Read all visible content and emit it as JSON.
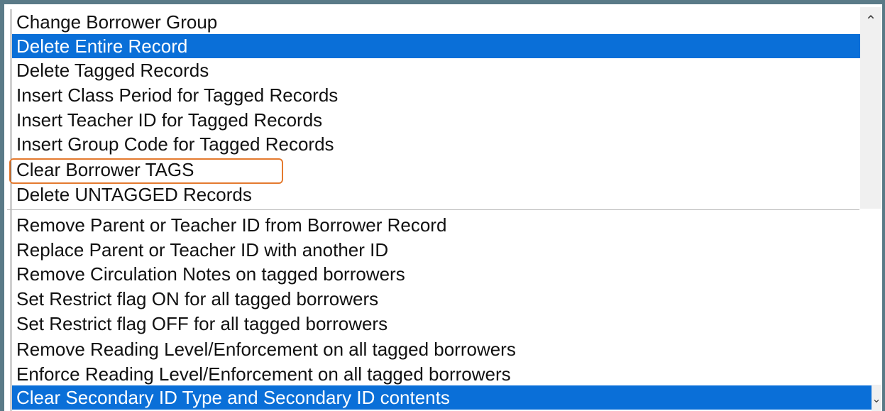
{
  "list": {
    "group1": [
      {
        "label": "Change Borrower Group",
        "selected": false
      },
      {
        "label": "Delete Entire Record",
        "selected": true
      },
      {
        "label": "Delete Tagged Records",
        "selected": false
      },
      {
        "label": "Insert Class Period for Tagged Records",
        "selected": false
      },
      {
        "label": "Insert Teacher ID for Tagged Records",
        "selected": false
      },
      {
        "label": "Insert Group Code for Tagged Records",
        "selected": false
      },
      {
        "label": "Clear Borrower TAGS",
        "selected": false,
        "highlighted": true
      },
      {
        "label": "Delete UNTAGGED Records",
        "selected": false
      }
    ],
    "group2": [
      {
        "label": "Remove Parent or Teacher ID from Borrower Record",
        "selected": false
      },
      {
        "label": "Replace Parent or Teacher ID with another ID",
        "selected": false
      },
      {
        "label": "Remove Circulation Notes on tagged borrowers",
        "selected": false
      },
      {
        "label": "Set Restrict flag ON for all tagged borrowers",
        "selected": false
      },
      {
        "label": "Set Restrict flag OFF for all tagged borrowers",
        "selected": false
      },
      {
        "label": "Remove Reading Level/Enforcement on all tagged borrowers",
        "selected": false
      },
      {
        "label": "Enforce Reading Level/Enforcement on all tagged borrowers",
        "selected": false
      },
      {
        "label": "Clear Secondary ID Type and Secondary ID contents",
        "selected": true
      }
    ]
  },
  "scroll": {
    "up_icon": "chevron-up-icon",
    "down_icon": "chevron-down-icon"
  },
  "colors": {
    "selection": "#0a6fd8",
    "highlight_box": "#e47a2f",
    "frame": "#5a7a87"
  }
}
